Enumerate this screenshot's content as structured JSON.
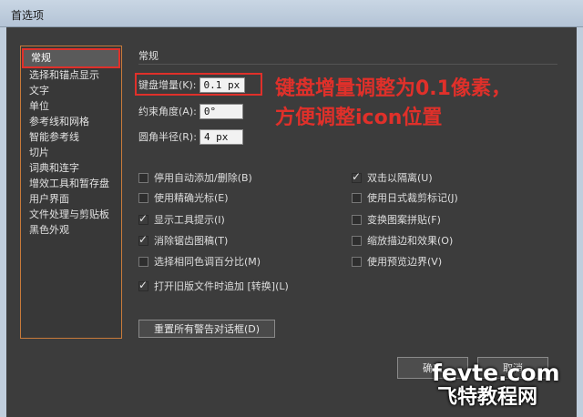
{
  "window": {
    "title": "首选项"
  },
  "sidebar": {
    "items": [
      {
        "label": "常规"
      },
      {
        "label": "选择和锚点显示"
      },
      {
        "label": "文字"
      },
      {
        "label": "单位"
      },
      {
        "label": "参考线和网格"
      },
      {
        "label": "智能参考线"
      },
      {
        "label": "切片"
      },
      {
        "label": "词典和连字"
      },
      {
        "label": "增效工具和暂存盘"
      },
      {
        "label": "用户界面"
      },
      {
        "label": "文件处理与剪贴板"
      },
      {
        "label": "黑色外观"
      }
    ]
  },
  "main": {
    "section_title": "常规",
    "fields": {
      "keyboard_increment": {
        "label": "键盘增量(K):",
        "value": "0.1 px"
      },
      "constrain_angle": {
        "label": "约束角度(A):",
        "value": "0°"
      },
      "corner_radius": {
        "label": "圆角半径(R):",
        "value": "4 px"
      }
    },
    "annotation": {
      "line1": "键盘增量调整为0.1像素，",
      "line2": "方便调整icon位置"
    },
    "options_left": [
      {
        "label": "停用自动添加/删除(B)",
        "checked": false
      },
      {
        "label": "使用精确光标(E)",
        "checked": false
      },
      {
        "label": "显示工具提示(I)",
        "checked": true
      },
      {
        "label": "消除锯齿图稿(T)",
        "checked": true
      },
      {
        "label": "选择相同色调百分比(M)",
        "checked": false
      },
      {
        "label": "打开旧版文件时追加 [转换](L)",
        "checked": true
      }
    ],
    "options_right": [
      {
        "label": "双击以隔离(U)",
        "checked": true
      },
      {
        "label": "使用日式裁剪标记(J)",
        "checked": false
      },
      {
        "label": "变换图案拼贴(F)",
        "checked": false
      },
      {
        "label": "缩放描边和效果(O)",
        "checked": false
      },
      {
        "label": "使用预览边界(V)",
        "checked": false
      }
    ],
    "reset_button": "重置所有警告对话框(D)"
  },
  "footer": {
    "ok_label": "确定",
    "cancel_label": "取消"
  },
  "watermark": {
    "top": "fevte.com",
    "bottom": "飞特教程网"
  }
}
